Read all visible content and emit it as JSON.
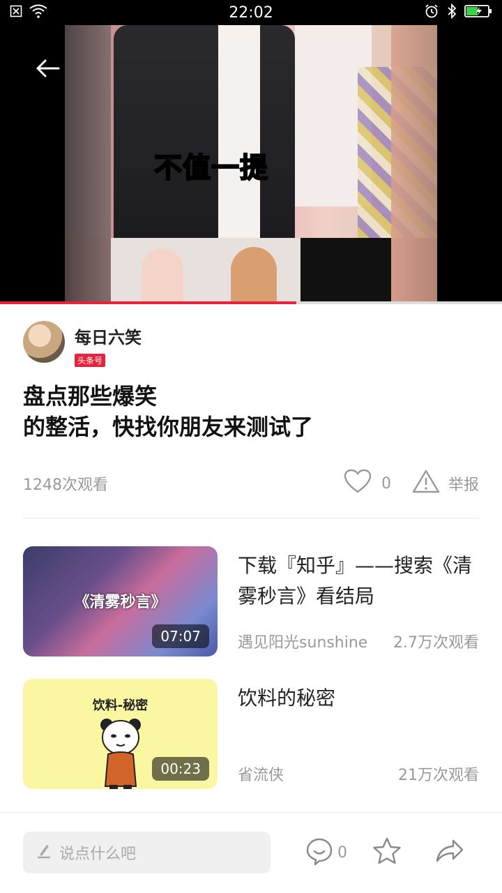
{
  "status_bar": {
    "time": "22:02"
  },
  "video": {
    "caption": "不值一提",
    "progress_percent": 59
  },
  "author": {
    "name": "每日六笑",
    "badge": "头条号"
  },
  "article": {
    "title_line1": "盘点那些爆笑",
    "title_line2": "的整活，快找你朋友来测试了",
    "views": "1248次观看",
    "like_count": "0",
    "report_label": "举报"
  },
  "related": [
    {
      "title": "下载『知乎』——搜索《清雾秒言》看结局",
      "thumb_text": "《清雾秒言》",
      "duration": "07:07",
      "author": "遇见阳光sunshine",
      "views": "2.7万次观看"
    },
    {
      "title": "饮料的秘密",
      "thumb_text": "饮料-秘密",
      "duration": "00:23",
      "author": "省流侠",
      "views": "21万次观看"
    }
  ],
  "bottom_bar": {
    "comment_placeholder": "说点什么吧",
    "comment_count": "0"
  },
  "colors": {
    "accent": "#e8223a",
    "battery": "#3ecf4a"
  },
  "icons": [
    "close-notification-icon",
    "wifi-icon",
    "alarm-icon",
    "bluetooth-icon",
    "battery-icon",
    "back-arrow-icon",
    "heart-icon",
    "warning-icon",
    "pen-icon",
    "comment-icon",
    "star-icon",
    "share-icon"
  ]
}
